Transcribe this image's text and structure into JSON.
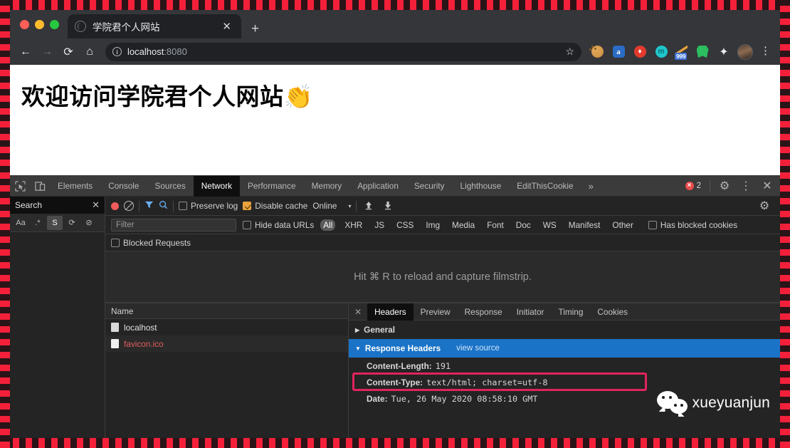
{
  "browser": {
    "tab": {
      "title": "学院君个人网站",
      "favicon": "globe-icon",
      "close": "✕"
    },
    "new_tab": "+",
    "nav": {
      "back": "←",
      "forward": "→",
      "reload": "⟳",
      "home": "⌂"
    },
    "omnibox": {
      "info_icon": "i",
      "url_host": "localhost",
      "url_port": ":8080",
      "bookmark_star": "☆"
    },
    "extensions": [
      {
        "name": "cookie-manager-icon",
        "label": ""
      },
      {
        "name": "amazon-assistant-icon",
        "label": "a"
      },
      {
        "name": "flame-extension-icon",
        "label": "♦"
      },
      {
        "name": "teal-extension-icon",
        "label": "m"
      },
      {
        "name": "rss-reader-icon",
        "label": "",
        "badge": "999"
      },
      {
        "name": "evernote-icon",
        "label": ""
      },
      {
        "name": "extensions-puzzle-icon",
        "label": "✦"
      }
    ],
    "profile_avatar": "avatar",
    "menu": "⋮"
  },
  "page": {
    "heading": "欢迎访问学院君个人网站",
    "heading_emoji": "👏"
  },
  "devtools": {
    "inspect_icon": "cursor-inspect-icon",
    "device_icon": "device-toolbar-icon",
    "tabs": [
      {
        "label": "Elements",
        "active": false
      },
      {
        "label": "Console",
        "active": false
      },
      {
        "label": "Sources",
        "active": false
      },
      {
        "label": "Network",
        "active": true
      },
      {
        "label": "Performance",
        "active": false
      },
      {
        "label": "Memory",
        "active": false
      },
      {
        "label": "Application",
        "active": false
      },
      {
        "label": "Security",
        "active": false
      },
      {
        "label": "Lighthouse",
        "active": false
      },
      {
        "label": "EditThisCookie",
        "active": false
      }
    ],
    "more_tabs": "»",
    "errors": {
      "icon": "×",
      "count": "2"
    },
    "settings_icon": "⚙",
    "kebab_icon": "⋮",
    "close_icon": "✕",
    "search_panel": {
      "title": "Search",
      "close": "✕",
      "tools": [
        {
          "name": "match-case-icon",
          "label": "Aa",
          "selected": false
        },
        {
          "name": "regex-icon",
          "label": ".*",
          "selected": false
        },
        {
          "name": "strict-icon",
          "label": "S",
          "selected": true
        },
        {
          "name": "refresh-icon",
          "label": "⟳",
          "selected": false
        },
        {
          "name": "clear-icon",
          "label": "⊘",
          "selected": false
        }
      ]
    },
    "network": {
      "toolbar": {
        "record_icon": "record-icon",
        "clear_icon": "clear-icon",
        "filter_icon": "funnel-icon",
        "search_icon": "search-icon",
        "preserve_log": {
          "label": "Preserve log",
          "checked": false
        },
        "disable_cache": {
          "label": "Disable cache",
          "checked": true
        },
        "throttling": "Online",
        "throttling_caret": "▾",
        "import_icon": "⬆",
        "export_icon": "⬇",
        "settings_icon": "⚙"
      },
      "filterbar": {
        "filter_placeholder": "Filter",
        "hide_data_urls": {
          "label": "Hide data URLs",
          "checked": false
        },
        "types": [
          {
            "label": "All",
            "selected": true
          },
          {
            "label": "XHR",
            "selected": false
          },
          {
            "label": "JS",
            "selected": false
          },
          {
            "label": "CSS",
            "selected": false
          },
          {
            "label": "Img",
            "selected": false
          },
          {
            "label": "Media",
            "selected": false
          },
          {
            "label": "Font",
            "selected": false
          },
          {
            "label": "Doc",
            "selected": false
          },
          {
            "label": "WS",
            "selected": false
          },
          {
            "label": "Manifest",
            "selected": false
          },
          {
            "label": "Other",
            "selected": false
          }
        ],
        "has_blocked_cookies": {
          "label": "Has blocked cookies",
          "checked": false
        }
      },
      "blocked_requests": {
        "label": "Blocked Requests",
        "checked": false
      },
      "filmstrip_hint": "Hit ⌘ R to reload and capture filmstrip.",
      "requests": {
        "column_name": "Name",
        "rows": [
          {
            "name": "localhost",
            "error": false
          },
          {
            "name": "favicon.ico",
            "error": true
          }
        ]
      },
      "detail": {
        "close": "✕",
        "tabs": [
          {
            "label": "Headers",
            "active": true
          },
          {
            "label": "Preview",
            "active": false
          },
          {
            "label": "Response",
            "active": false
          },
          {
            "label": "Initiator",
            "active": false
          },
          {
            "label": "Timing",
            "active": false
          },
          {
            "label": "Cookies",
            "active": false
          }
        ],
        "general_section": {
          "label": "General",
          "expanded": false,
          "triangle": "▶"
        },
        "response_headers_section": {
          "label": "Response Headers",
          "expanded": true,
          "triangle": "▼",
          "view_source": "view source"
        },
        "headers": [
          {
            "key": "Content-Length:",
            "value": "191",
            "highlighted": false
          },
          {
            "key": "Content-Type:",
            "value": "text/html; charset=utf-8",
            "highlighted": true
          },
          {
            "key": "Date:",
            "value": "Tue, 26 May 2020 08:58:10 GMT",
            "highlighted": false
          }
        ]
      }
    }
  },
  "watermark": {
    "text": "xueyuanjun",
    "logo": "wechat-logo"
  },
  "colors": {
    "frame_red": "#f4203a",
    "highlight_border": "#e0245e",
    "section_blue": "#1a73c7",
    "error_red": "#e35d5d",
    "accent_orange": "#e8a33d"
  }
}
